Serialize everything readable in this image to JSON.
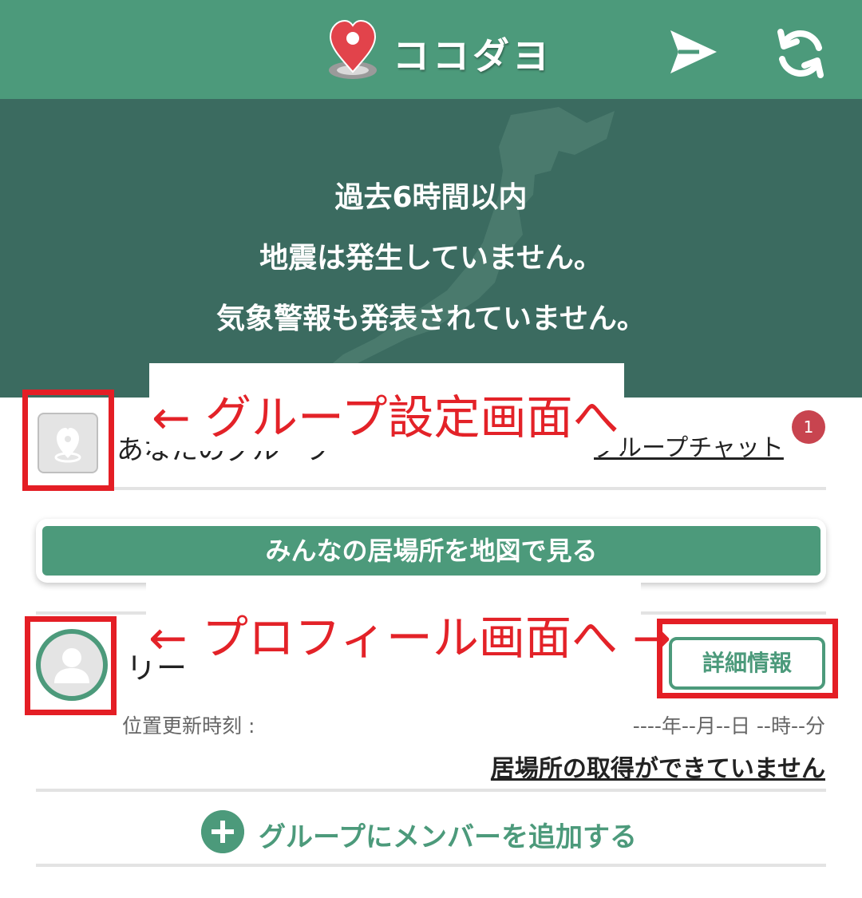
{
  "header": {
    "title": "ココダヨ",
    "send_icon": "send-icon",
    "refresh_icon": "refresh-icon"
  },
  "banner": {
    "line1": "過去6時間以内",
    "line2": "地震は発生していません。",
    "line3": "気象警報も発表されていません。"
  },
  "annotations": {
    "group_settings": "← グループ設定画面へ",
    "profile": "← プロフィール画面へ →"
  },
  "group": {
    "name": "あなたのグループ",
    "chat_label": "グループチャット",
    "chat_badge": "1"
  },
  "map_button": {
    "label": "みんなの居場所を地図で見る"
  },
  "member": {
    "name": "リー",
    "detail_label": "詳細情報",
    "update_label": "位置更新時刻 :",
    "update_value": "----年--月--日 --時--分",
    "location_status": "居場所の取得ができていません"
  },
  "add_member": {
    "label": "グループにメンバーを追加する"
  },
  "colors": {
    "primary": "#4c9a7b",
    "banner": "#3b6b60",
    "annotation": "#e41e25",
    "badge": "#c8444f"
  }
}
